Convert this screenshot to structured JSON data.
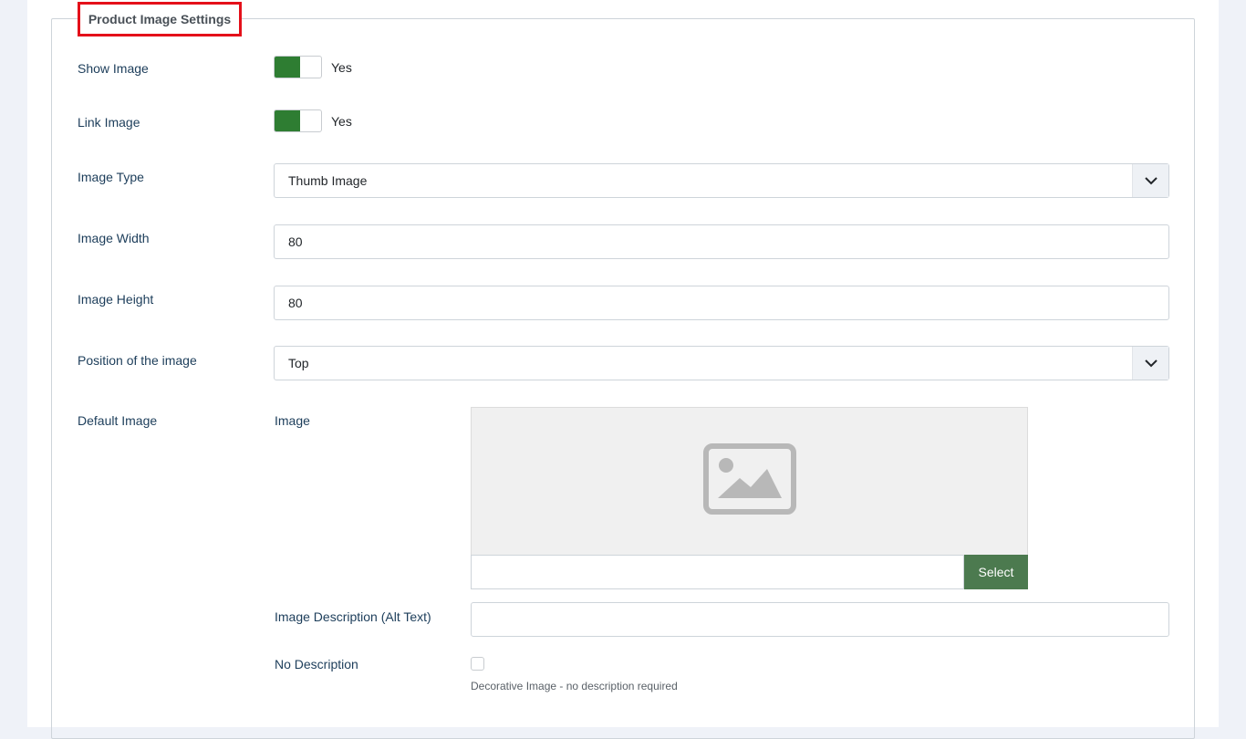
{
  "legend": "Product Image Settings",
  "show_image": {
    "label": "Show Image",
    "value": "Yes",
    "enabled": true
  },
  "link_image": {
    "label": "Link Image",
    "value": "Yes",
    "enabled": true
  },
  "image_type": {
    "label": "Image Type",
    "value": "Thumb Image"
  },
  "image_width": {
    "label": "Image Width",
    "value": "80"
  },
  "image_height": {
    "label": "Image Height",
    "value": "80"
  },
  "image_position": {
    "label": "Position of the image",
    "value": "Top"
  },
  "default_image": {
    "label": "Default Image",
    "image_label": "Image",
    "select_label": "Select",
    "path_value": "",
    "placeholder_icon": "image-placeholder-icon"
  },
  "alt_text": {
    "label": "Image Description (Alt Text)",
    "value": ""
  },
  "no_description": {
    "label": "No Description",
    "checked": false,
    "hint": "Decorative Image - no description required"
  },
  "colors": {
    "switch_on": "#2e7d32",
    "select_button": "#4c7a4f",
    "highlight_border": "#e4101a"
  }
}
